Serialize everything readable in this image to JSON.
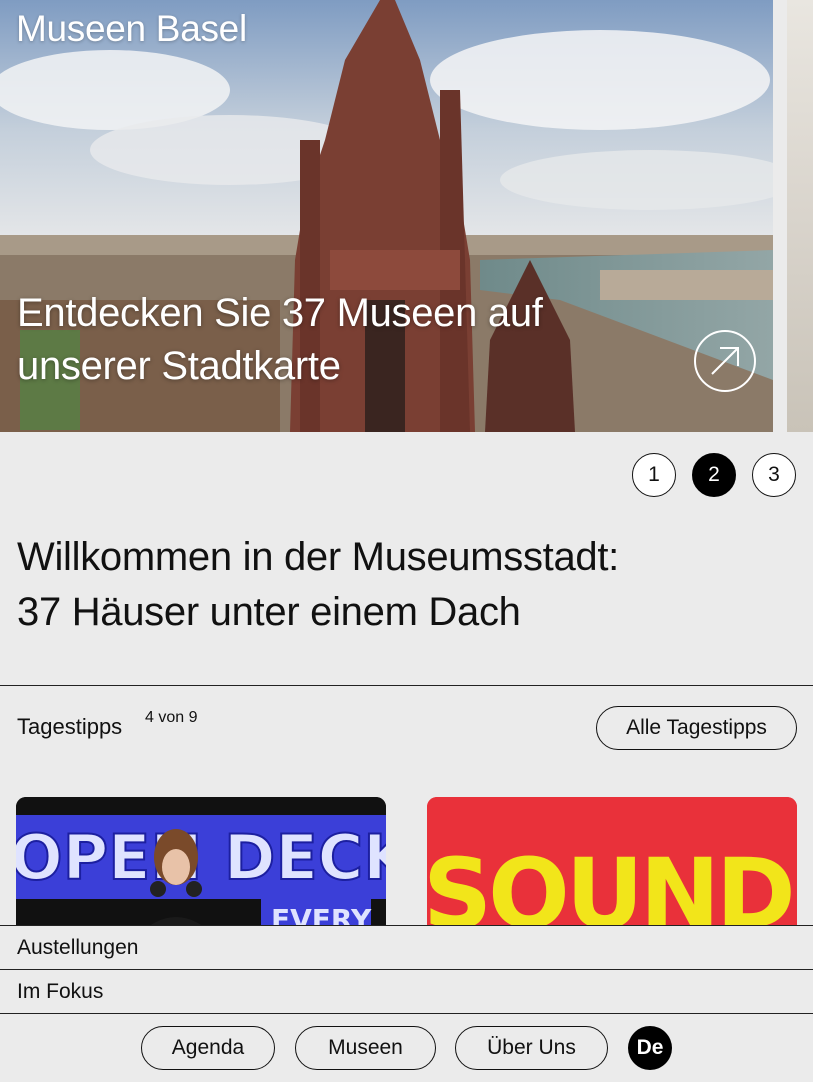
{
  "header": {
    "site_title": "Museen Basel"
  },
  "hero": {
    "caption_line1": "Entdecken Sie 37 Museen auf",
    "caption_line2": "unserer Stadtkarte",
    "arrow_icon": "arrow-up-right-icon"
  },
  "slider": {
    "pages": [
      "1",
      "2",
      "3"
    ],
    "active": 2
  },
  "welcome": {
    "line1": "Willkommen in der Museumsstadt:",
    "line2": "37 Häuser unter einem Dach"
  },
  "tips": {
    "label": "Tagestipps",
    "count": "4 von 9",
    "all_button": "Alle Tagestipps",
    "cards": [
      {
        "image_text": "OPEN DECKS",
        "image_subtext": "EVERY"
      },
      {
        "image_text": "SOUND POP"
      }
    ]
  },
  "nav": {
    "exhibitions": "Austellungen",
    "focus": "Im Fokus",
    "agenda": "Agenda",
    "museums": "Museen",
    "about": "Über Uns",
    "language": "De"
  },
  "colors": {
    "background": "#ebebeb",
    "accent": "#000000",
    "card_red": "#e9313a",
    "card_yellow": "#f2e51a"
  }
}
